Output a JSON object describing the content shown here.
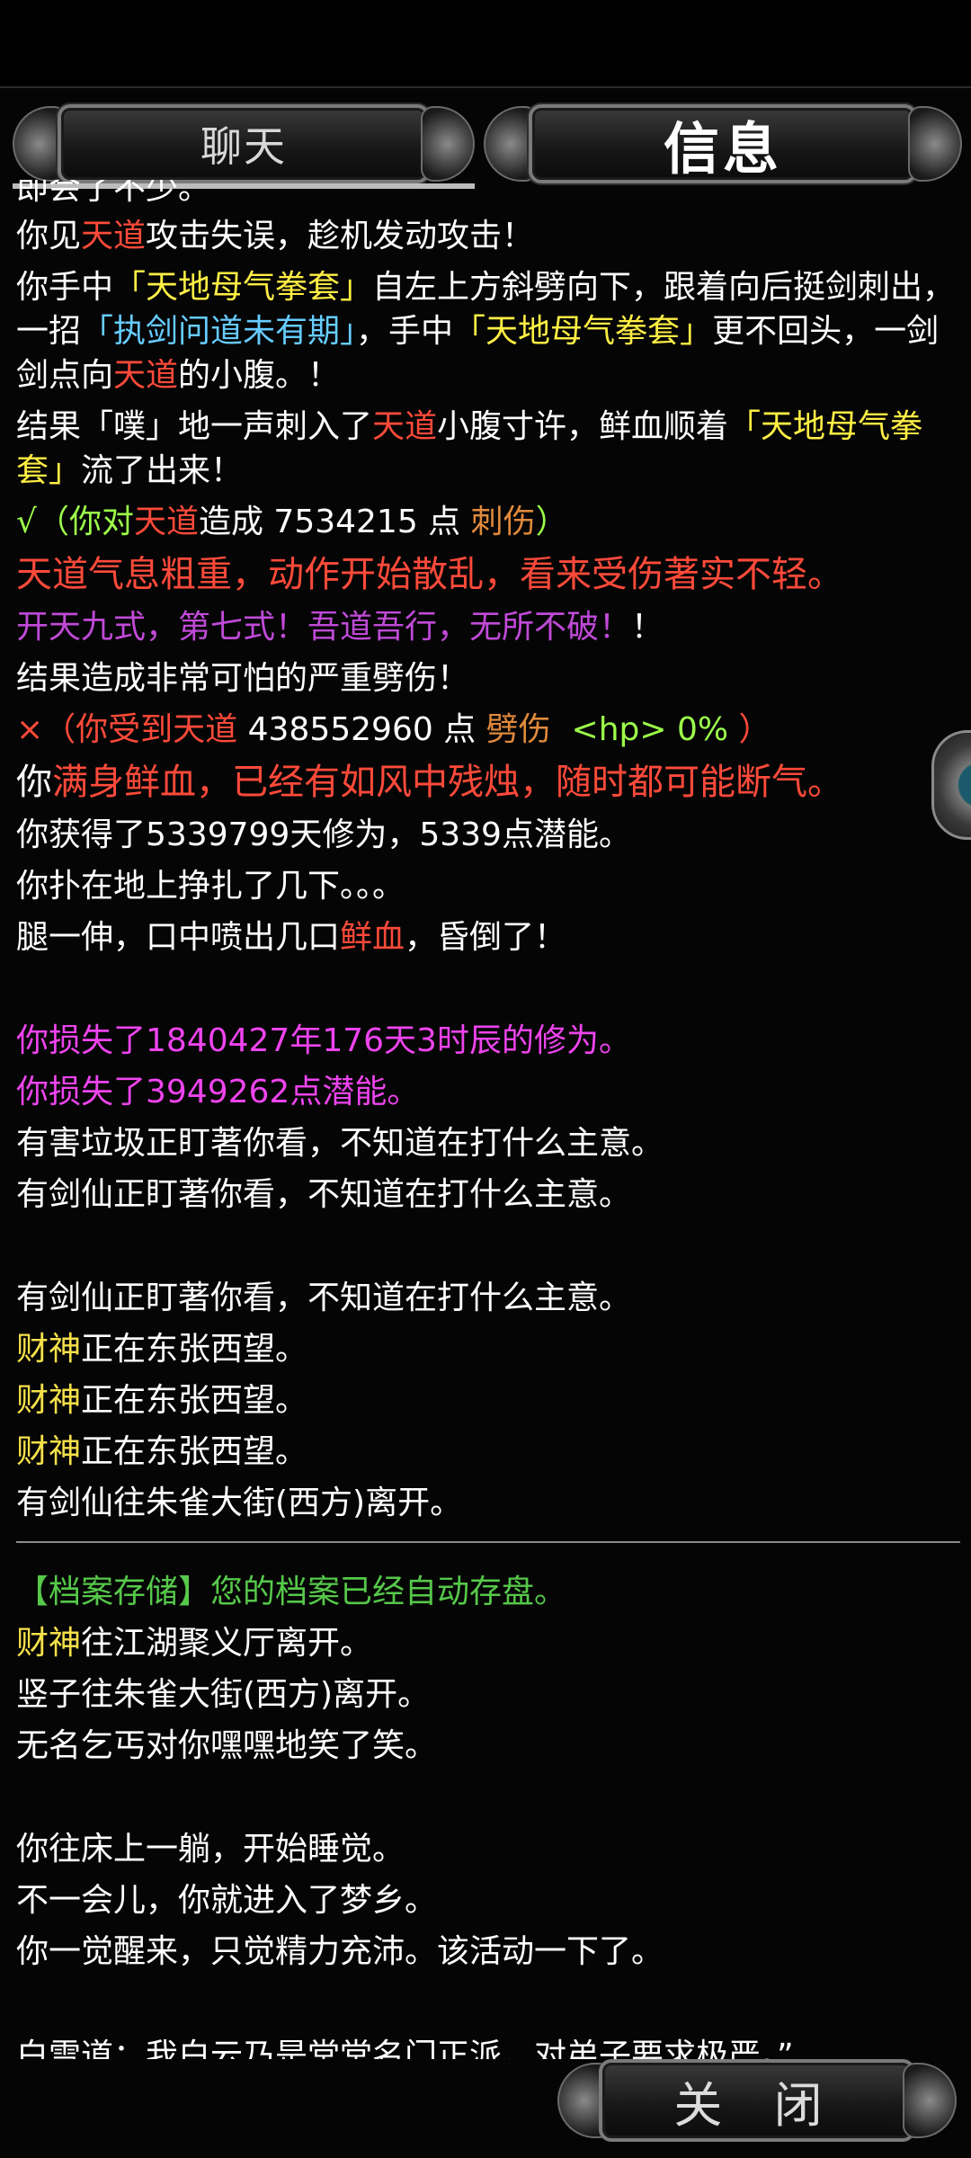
{
  "tabs": {
    "chat": "聊天",
    "info": "信息"
  },
  "close_label": "关 闭",
  "log": {
    "top_cut": "即会了不少。",
    "l1": [
      "你见",
      "天道",
      "攻击失误，趁机发动攻击！"
    ],
    "l2": [
      "你手中",
      "「天地母气拳套」",
      "自左上方斜劈向下，跟着向后挺剑刺出，一招",
      "「执剑问道未有期」",
      "，手中",
      "「天地母气拳套」",
      "更不回头，一剑剑点向",
      "天道",
      "的小腹。！"
    ],
    "l3": [
      "结果「噗」地一声刺入了",
      "天道",
      "小腹寸许，鲜血顺着",
      "「天地母气拳套」",
      "流了出来！"
    ],
    "l4": [
      "√（你对",
      "天道",
      "造成 7534215 点 ",
      "刺伤",
      "）"
    ],
    "l5": "天道气息粗重，动作开始散乱，看来受伤著实不轻。",
    "l6": [
      "开天九式，第七式！吾道吾行，无所不破！",
      "！"
    ],
    "l7": "结果造成非常可怕的严重劈伤！",
    "l8": [
      "×（你受到天道",
      " 438552960 点 ",
      "劈伤",
      "  <hp> 0%",
      " ）"
    ],
    "l9": [
      "你",
      "满身鲜血，已经有如风中残烛，随时都可能断气。"
    ],
    "l10": "你获得了5339799天修为，5339点潜能。",
    "l11": "你扑在地上挣扎了几下。。。",
    "l12": [
      "腿一伸，口中喷出几口",
      "鲜血",
      "，昏倒了！"
    ],
    "l13": "你损失了1840427年176天3时辰的修为。",
    "l14": "你损失了3949262点潜能。",
    "l15": "有害垃圾正盯著你看，不知道在打什么主意。",
    "l16": "有剑仙正盯著你看，不知道在打什么主意。",
    "l17": "有剑仙正盯著你看，不知道在打什么主意。",
    "l18": [
      "财神",
      "正在东张西望。"
    ],
    "l19": [
      "财神",
      "正在东张西望。"
    ],
    "l20": [
      "财神",
      "正在东张西望。"
    ],
    "l21": "有剑仙往朱雀大街(西方)离开。",
    "l22": "【档案存储】您的档案已经自动存盘。",
    "l23": [
      "财神",
      "往江湖聚义厅离开。"
    ],
    "l24": "竖子往朱雀大街(西方)离开。",
    "l25": "无名乞丐对你嘿嘿地笑了笑。",
    "l26": "你往床上一躺，开始睡觉。",
    "l27": "不一会儿，你就进入了梦乡。",
    "l28": "你一觉醒来，只觉精力充沛。该活动一下了。",
    "l29": "白雪道：我白云乃是堂堂名门正派，对弟子要求极严。”"
  }
}
